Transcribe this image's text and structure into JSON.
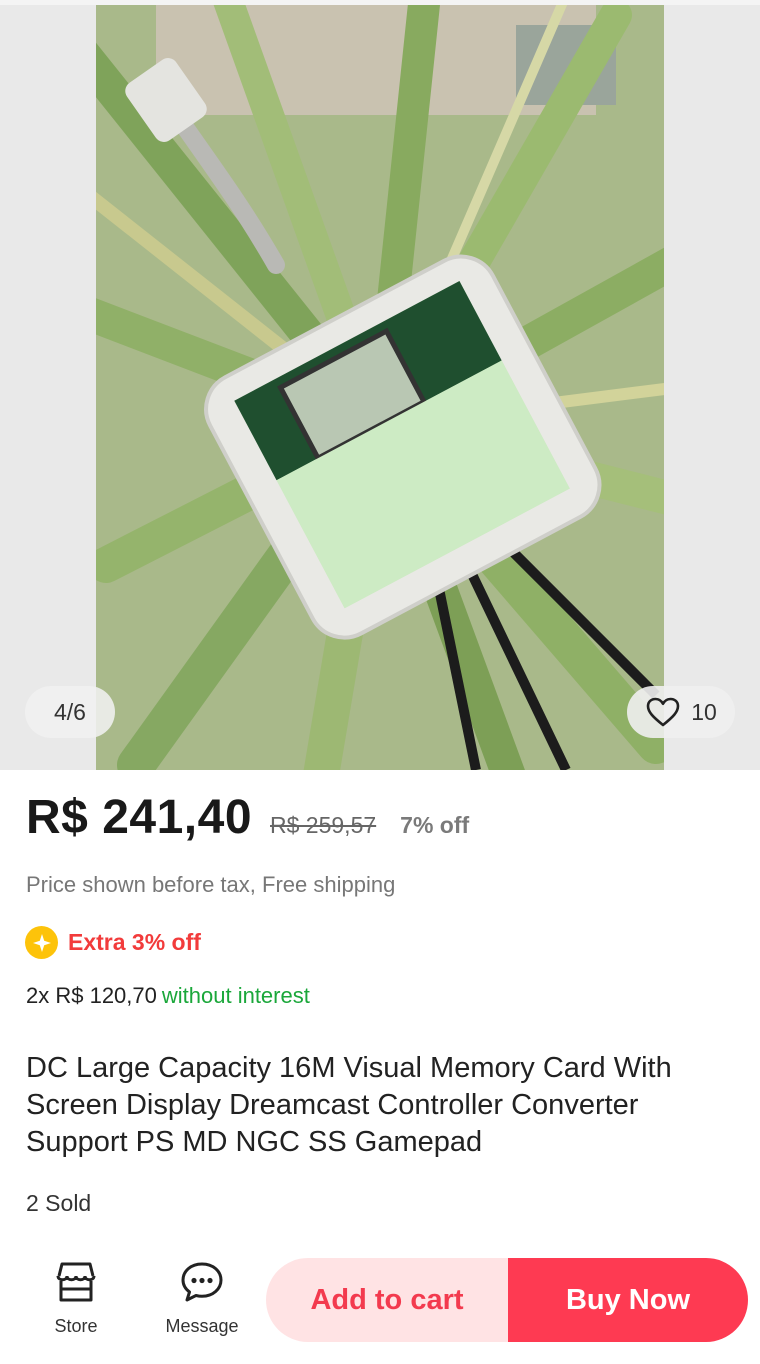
{
  "gallery": {
    "counter": "4/6",
    "favorite_count": "10",
    "image_description": "Product photo"
  },
  "price": {
    "current": "R$ 241,40",
    "original": "R$ 259,57",
    "discount": "7% off",
    "tax_note": "Price shown before tax, Free shipping"
  },
  "promo": {
    "extra_label": "Extra 3% off",
    "coin_color": "#fdc30a"
  },
  "installments": {
    "amount": "2x R$ 120,70",
    "note": "without interest"
  },
  "product": {
    "title": "DC Large Capacity 16M Visual Memory Card With Screen Display Dreamcast Controller Converter Support PS MD NGC SS Gamepad",
    "sold": "2 Sold"
  },
  "bottom_bar": {
    "store_label": "Store",
    "message_label": "Message",
    "add_to_cart_label": "Add to cart",
    "buy_now_label": "Buy Now",
    "accent_color": "#fe3a52"
  }
}
